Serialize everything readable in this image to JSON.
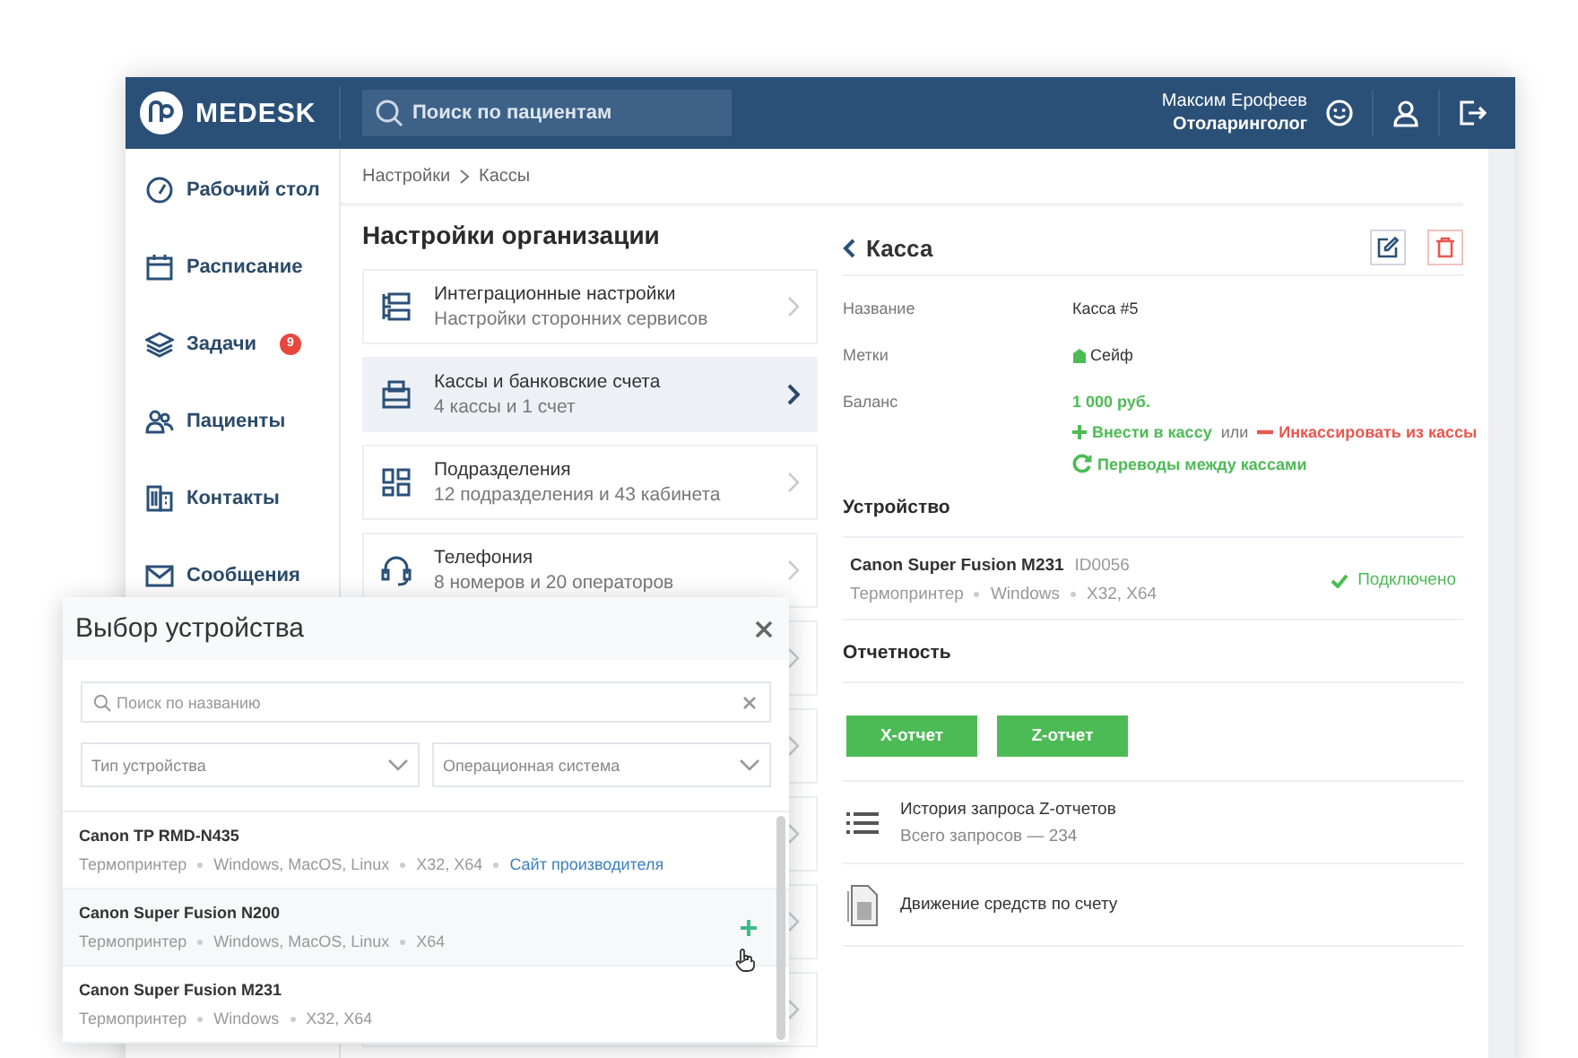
{
  "header": {
    "logo": "MEDESK",
    "search_placeholder": "Поиск по пациентам",
    "user_name": "Максим Ерофеев",
    "user_role": "Отоларинголог"
  },
  "sidebar": {
    "items": [
      {
        "label": "Рабочий стол"
      },
      {
        "label": "Расписание"
      },
      {
        "label": "Задачи",
        "badge": "9"
      },
      {
        "label": "Пациенты"
      },
      {
        "label": "Контакты"
      },
      {
        "label": "Сообщения"
      }
    ]
  },
  "breadcrumb": [
    "Настройки",
    "Кассы"
  ],
  "settings": {
    "title": "Настройки организации",
    "items": [
      {
        "title": "Интеграционные настройки",
        "subtitle": "Настройки сторонних сервисов",
        "selected": false
      },
      {
        "title": "Кассы и банковские счета",
        "subtitle": "4 кассы и 1 счет",
        "selected": true
      },
      {
        "title": "Подразделения",
        "subtitle": "12 подразделения и 43 кабинета",
        "selected": false
      },
      {
        "title": "Телефония",
        "subtitle": "8 номеров и 20 операторов",
        "selected": false
      }
    ]
  },
  "detail": {
    "title": "Касса",
    "fields": [
      {
        "label": "Название",
        "value": "Касса #5",
        "kind": "text"
      },
      {
        "label": "Метки",
        "value": "Сейф",
        "kind": "tag"
      },
      {
        "label": "Баланс",
        "value": "1 000 руб.",
        "kind": "balance"
      }
    ],
    "deposit": "Внести в кассу",
    "or": "или",
    "withdraw": "Инкассировать из кассы",
    "transfers": "Переводы между кассами",
    "device_heading": "Устройство",
    "device": {
      "name": "Canon Super Fusion M231",
      "id": "ID0056",
      "meta": [
        "Термопринтер",
        "Windows",
        "X32, X64"
      ],
      "status": "Подключено",
      "connected": true
    },
    "reports_heading": "Отчетность",
    "report_buttons": [
      "X-отчет",
      "Z-отчет"
    ],
    "links": [
      {
        "title": "История запроса Z-отчетов",
        "subtitle": "Всего запросов — 234"
      },
      {
        "title": "Движение средств по счету"
      }
    ]
  },
  "modal": {
    "title": "Выбор устройства",
    "search_placeholder": "Поиск по названию",
    "filters": [
      "Тип устройства",
      "Операционная система"
    ],
    "devices": [
      {
        "name": "Canon TP RMD-N435",
        "meta": [
          "Термопринтер",
          "Windows, MacOS, Linux",
          "X32, X64"
        ],
        "link": "Сайт производителя",
        "selected": false
      },
      {
        "name": "Canon Super Fusion N200",
        "meta": [
          "Термопринтер",
          "Windows, MacOS, Linux",
          "X64"
        ],
        "selected": true
      },
      {
        "name": "Canon Super Fusion M231",
        "meta": [
          "Термопринтер",
          "Windows",
          "X32, X64"
        ],
        "selected": false
      }
    ]
  }
}
